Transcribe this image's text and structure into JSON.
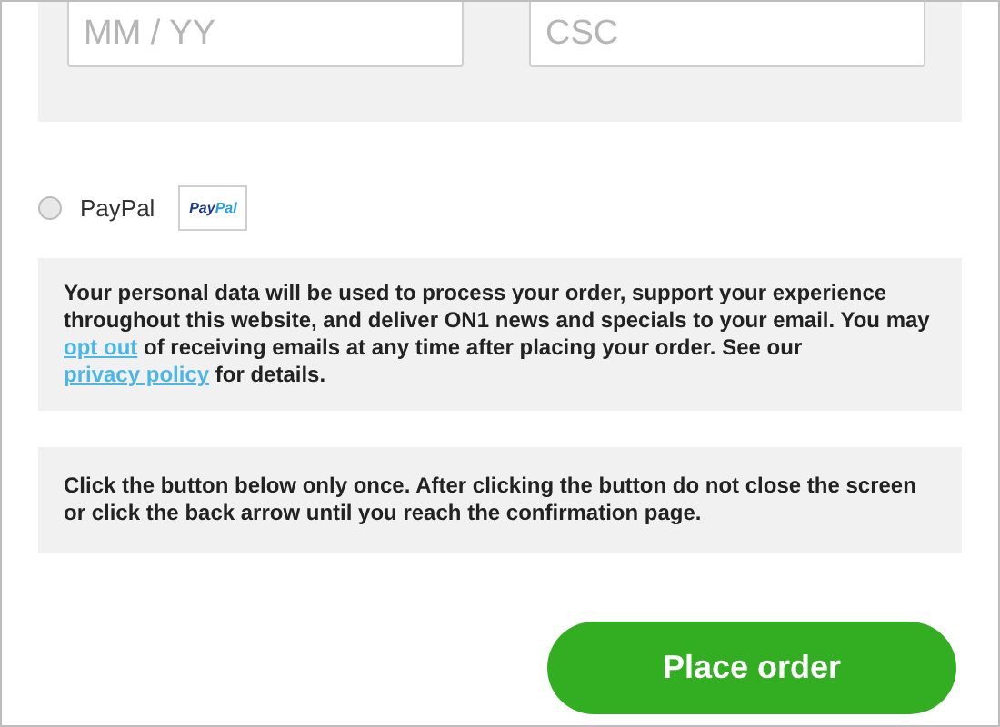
{
  "card_fields": [
    {
      "placeholder": "MM / YY"
    },
    {
      "placeholder": "CSC"
    }
  ],
  "payment_option": {
    "label": "PayPal",
    "selected": false,
    "logo_parts": [
      "Pay",
      "Pal"
    ]
  },
  "privacy_notice": {
    "parts": [
      {
        "kind": "text",
        "text": "Your personal data will be used to process your order, support your experience throughout this website, and deliver ON1 news and specials to your email. You may "
      },
      {
        "kind": "link",
        "text": "opt out"
      },
      {
        "kind": "text",
        "text": " of receiving emails at any time after placing your order. See our "
      },
      {
        "kind": "link",
        "text": "privacy policy"
      },
      {
        "kind": "text",
        "text": " for details."
      }
    ]
  },
  "click_notice": "Click the button below only once. After clicking the button do not close the screen or click the back arrow until you reach the confirmation page.",
  "submit_button": "Place order"
}
